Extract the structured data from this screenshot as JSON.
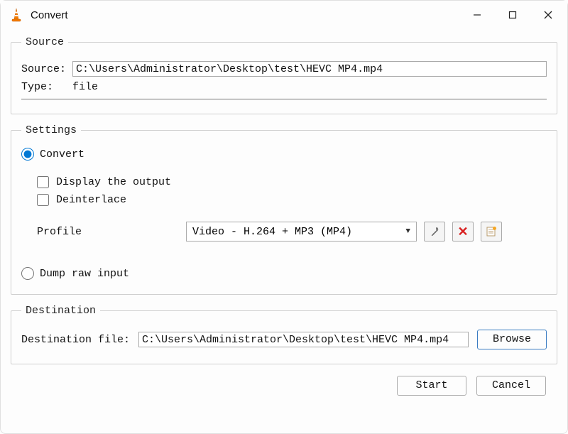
{
  "window": {
    "title": "Convert"
  },
  "source_group": {
    "legend": "Source",
    "source_label": "Source:",
    "source_value": "C:\\Users\\Administrator\\Desktop\\test\\HEVC MP4.mp4",
    "type_label": "Type:",
    "type_value": "file"
  },
  "settings_group": {
    "legend": "Settings",
    "convert_label": "Convert",
    "display_output_label": "Display the output",
    "deinterlace_label": "Deinterlace",
    "profile_label": "Profile",
    "profile_value": "Video - H.264 + MP3 (MP4)",
    "dump_label": "Dump raw input"
  },
  "destination_group": {
    "legend": "Destination",
    "dest_label": "Destination file:",
    "dest_value": "C:\\Users\\Administrator\\Desktop\\test\\HEVC MP4.mp4",
    "browse_label": "Browse"
  },
  "footer": {
    "start_label": "Start",
    "cancel_label": "Cancel"
  }
}
